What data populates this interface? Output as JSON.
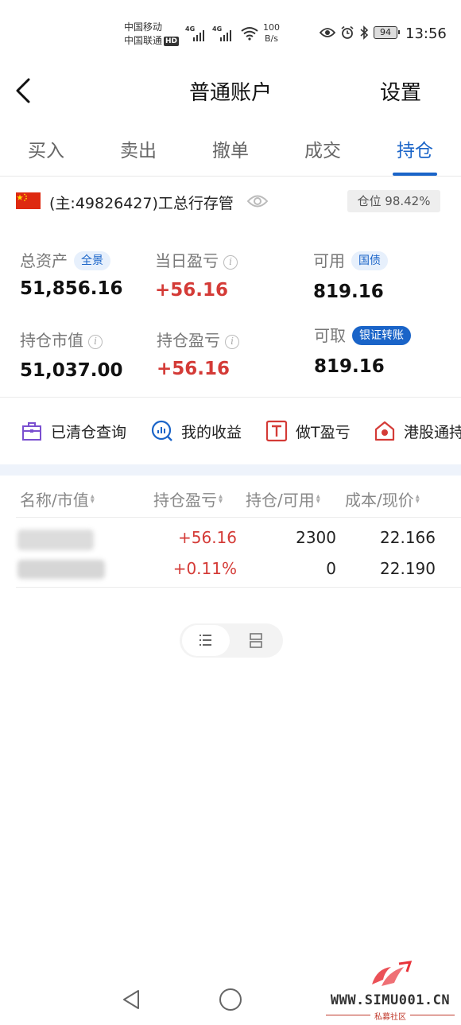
{
  "status_bar": {
    "carrier1": "中国移动",
    "carrier2": "中国联通",
    "hd": "HD",
    "net1": "4G",
    "net2": "4G",
    "speed_value": "100",
    "speed_unit": "B/s",
    "battery": "94",
    "time": "13:56"
  },
  "header": {
    "title": "普通账户",
    "settings": "设置"
  },
  "tabs": [
    {
      "label": "买入"
    },
    {
      "label": "卖出"
    },
    {
      "label": "撤单"
    },
    {
      "label": "成交"
    },
    {
      "label": "持仓",
      "active": true
    }
  ],
  "account": {
    "name": "(主:49826427)工总行存管",
    "position_ratio": "仓位 98.42%"
  },
  "assets": {
    "total_label": "总资产",
    "total_tag": "全景",
    "total_value": "51,856.16",
    "daily_pl_label": "当日盈亏",
    "daily_pl_value": "+56.16",
    "available_label": "可用",
    "available_tag": "国债",
    "available_value": "819.16",
    "market_value_label": "持仓市值",
    "market_value": "51,037.00",
    "position_pl_label": "持仓盈亏",
    "position_pl_value": "+56.16",
    "withdrawable_label": "可取",
    "withdrawable_tag": "银证转账",
    "withdrawable_value": "819.16"
  },
  "quick_actions": [
    {
      "label": "已清仓查询",
      "icon": "briefcase-icon"
    },
    {
      "label": "我的收益",
      "icon": "chart-search-icon"
    },
    {
      "label": "做T盈亏",
      "icon": "t-box-icon"
    },
    {
      "label": "港股通持",
      "icon": "hk-house-icon"
    }
  ],
  "table": {
    "headers": [
      "名称/市值",
      "持仓盈亏",
      "持仓/可用",
      "成本/现价"
    ],
    "rows": [
      {
        "pl": "+56.16",
        "pl_pct": "+0.11%",
        "position": "2300",
        "available": "0",
        "cost": "22.166",
        "price": "22.190"
      }
    ]
  },
  "watermark": {
    "url": "WWW.SIMU001.CN",
    "sub": "私募社区"
  },
  "colors": {
    "accent": "#1a64c8",
    "profit": "#d43b37"
  }
}
